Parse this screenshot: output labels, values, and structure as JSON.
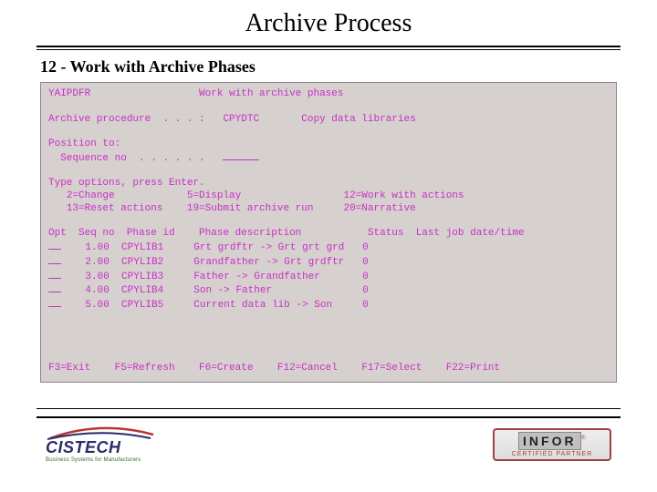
{
  "title": "Archive Process",
  "subtitle": "12 - Work with Archive Phases",
  "terminal": {
    "program": "YAIPDFR",
    "screen_title": "Work with archive phases",
    "proc_label": "Archive procedure  . . . :",
    "proc_code": "CPYDTC",
    "proc_desc": "Copy data libraries",
    "position_label": "Position to:",
    "seq_label": "  Sequence no  . . . . . .",
    "instruct": "Type options, press Enter.",
    "opts": {
      "o2": "2=Change",
      "o5": "5=Display",
      "o12": "12=Work with actions",
      "o13": "13=Reset actions",
      "o19": "19=Submit archive run",
      "o20": "20=Narrative"
    },
    "cols": {
      "opt": "Opt",
      "seq": "Seq no",
      "phase": "Phase id",
      "desc": "Phase description",
      "status": "Status",
      "last": "Last job date/time"
    },
    "rows": [
      {
        "seq": "1.00",
        "phase": "CPYLIB1",
        "desc": "Grt grdftr -> Grt grt grd",
        "status": "0"
      },
      {
        "seq": "2.00",
        "phase": "CPYLIB2",
        "desc": "Grandfather -> Grt grdftr",
        "status": "0"
      },
      {
        "seq": "3.00",
        "phase": "CPYLIB3",
        "desc": "Father -> Grandfather",
        "status": "0"
      },
      {
        "seq": "4.00",
        "phase": "CPYLIB4",
        "desc": "Son -> Father",
        "status": "0"
      },
      {
        "seq": "5.00",
        "phase": "CPYLIB5",
        "desc": "Current data lib -> Son",
        "status": "0"
      }
    ],
    "fkeys": {
      "f3": "F3=Exit",
      "f5": "F5=Refresh",
      "f6": "F6=Create",
      "f12": "F12=Cancel",
      "f17": "F17=Select",
      "f22": "F22=Print"
    }
  },
  "logos": {
    "cistech": "CISTECH",
    "cistech_tag": "Business Systems for Manufacturers",
    "infor": "INFOR",
    "infor_sub": "CERTIFIED PARTNER"
  }
}
